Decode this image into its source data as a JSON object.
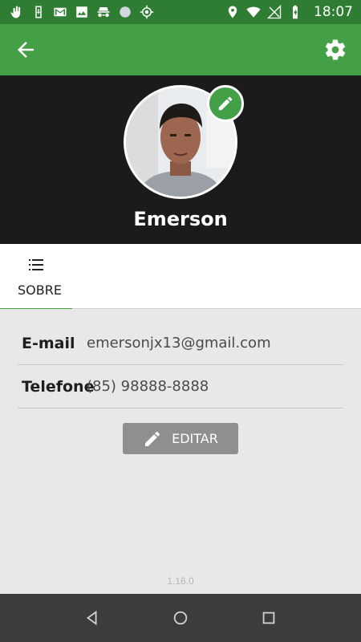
{
  "status_bar": {
    "time": "18:07",
    "icons": [
      "hand-icon",
      "phone-sync-icon",
      "gmail-icon",
      "image-icon",
      "incognito-icon",
      "circle-icon",
      "location-target-icon",
      "location-icon",
      "wifi-icon",
      "no-signal-icon",
      "battery-charging-icon"
    ]
  },
  "app_bar": {
    "back_icon": "arrow-back-icon",
    "settings_icon": "gear-icon"
  },
  "profile": {
    "name": "Emerson",
    "edit_photo_icon": "pencil-icon"
  },
  "tabs": [
    {
      "label": "SOBRE",
      "icon": "list-icon",
      "active": true
    }
  ],
  "details": {
    "email_label": "E-mail",
    "email_value": "emersonjx13@gmail.com",
    "phone_label": "Telefone",
    "phone_value": "(85) 98888-8888"
  },
  "edit_button": {
    "label": "EDITAR",
    "icon": "pencil-icon"
  },
  "version": "1.16.0",
  "nav_bar": {
    "buttons": [
      "back-triangle-icon",
      "home-circle-icon",
      "recents-square-icon"
    ]
  },
  "colors": {
    "status_bar": "#2e7d32",
    "app_bar": "#43a047",
    "header_bg": "#1b1b1b",
    "content_bg": "#e8e8e8",
    "button_bg": "#8f8f8f",
    "nav_bg": "#3c3c3c"
  }
}
